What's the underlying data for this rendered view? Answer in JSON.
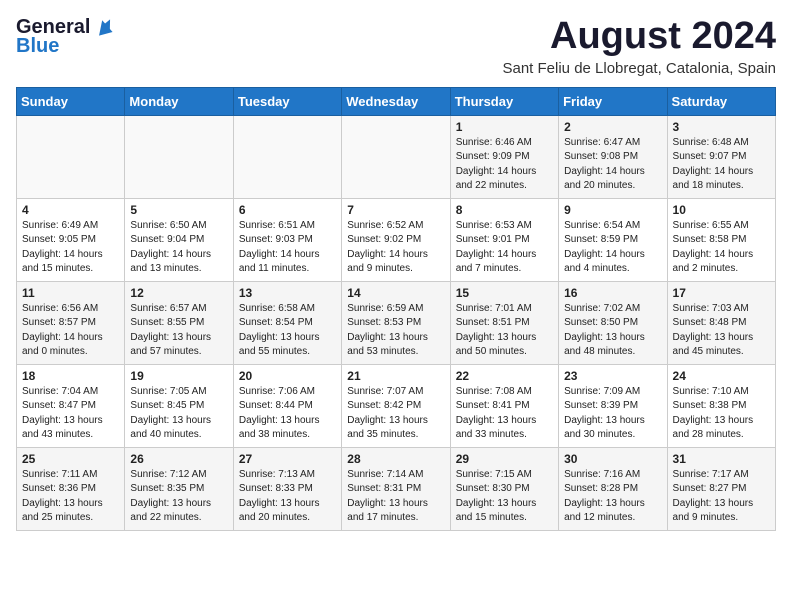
{
  "header": {
    "logo_general": "General",
    "logo_blue": "Blue",
    "month_title": "August 2024",
    "location": "Sant Feliu de Llobregat, Catalonia, Spain"
  },
  "calendar": {
    "weekdays": [
      "Sunday",
      "Monday",
      "Tuesday",
      "Wednesday",
      "Thursday",
      "Friday",
      "Saturday"
    ],
    "weeks": [
      [
        {
          "day": "",
          "info": ""
        },
        {
          "day": "",
          "info": ""
        },
        {
          "day": "",
          "info": ""
        },
        {
          "day": "",
          "info": ""
        },
        {
          "day": "1",
          "info": "Sunrise: 6:46 AM\nSunset: 9:09 PM\nDaylight: 14 hours\nand 22 minutes."
        },
        {
          "day": "2",
          "info": "Sunrise: 6:47 AM\nSunset: 9:08 PM\nDaylight: 14 hours\nand 20 minutes."
        },
        {
          "day": "3",
          "info": "Sunrise: 6:48 AM\nSunset: 9:07 PM\nDaylight: 14 hours\nand 18 minutes."
        }
      ],
      [
        {
          "day": "4",
          "info": "Sunrise: 6:49 AM\nSunset: 9:05 PM\nDaylight: 14 hours\nand 15 minutes."
        },
        {
          "day": "5",
          "info": "Sunrise: 6:50 AM\nSunset: 9:04 PM\nDaylight: 14 hours\nand 13 minutes."
        },
        {
          "day": "6",
          "info": "Sunrise: 6:51 AM\nSunset: 9:03 PM\nDaylight: 14 hours\nand 11 minutes."
        },
        {
          "day": "7",
          "info": "Sunrise: 6:52 AM\nSunset: 9:02 PM\nDaylight: 14 hours\nand 9 minutes."
        },
        {
          "day": "8",
          "info": "Sunrise: 6:53 AM\nSunset: 9:01 PM\nDaylight: 14 hours\nand 7 minutes."
        },
        {
          "day": "9",
          "info": "Sunrise: 6:54 AM\nSunset: 8:59 PM\nDaylight: 14 hours\nand 4 minutes."
        },
        {
          "day": "10",
          "info": "Sunrise: 6:55 AM\nSunset: 8:58 PM\nDaylight: 14 hours\nand 2 minutes."
        }
      ],
      [
        {
          "day": "11",
          "info": "Sunrise: 6:56 AM\nSunset: 8:57 PM\nDaylight: 14 hours\nand 0 minutes."
        },
        {
          "day": "12",
          "info": "Sunrise: 6:57 AM\nSunset: 8:55 PM\nDaylight: 13 hours\nand 57 minutes."
        },
        {
          "day": "13",
          "info": "Sunrise: 6:58 AM\nSunset: 8:54 PM\nDaylight: 13 hours\nand 55 minutes."
        },
        {
          "day": "14",
          "info": "Sunrise: 6:59 AM\nSunset: 8:53 PM\nDaylight: 13 hours\nand 53 minutes."
        },
        {
          "day": "15",
          "info": "Sunrise: 7:01 AM\nSunset: 8:51 PM\nDaylight: 13 hours\nand 50 minutes."
        },
        {
          "day": "16",
          "info": "Sunrise: 7:02 AM\nSunset: 8:50 PM\nDaylight: 13 hours\nand 48 minutes."
        },
        {
          "day": "17",
          "info": "Sunrise: 7:03 AM\nSunset: 8:48 PM\nDaylight: 13 hours\nand 45 minutes."
        }
      ],
      [
        {
          "day": "18",
          "info": "Sunrise: 7:04 AM\nSunset: 8:47 PM\nDaylight: 13 hours\nand 43 minutes."
        },
        {
          "day": "19",
          "info": "Sunrise: 7:05 AM\nSunset: 8:45 PM\nDaylight: 13 hours\nand 40 minutes."
        },
        {
          "day": "20",
          "info": "Sunrise: 7:06 AM\nSunset: 8:44 PM\nDaylight: 13 hours\nand 38 minutes."
        },
        {
          "day": "21",
          "info": "Sunrise: 7:07 AM\nSunset: 8:42 PM\nDaylight: 13 hours\nand 35 minutes."
        },
        {
          "day": "22",
          "info": "Sunrise: 7:08 AM\nSunset: 8:41 PM\nDaylight: 13 hours\nand 33 minutes."
        },
        {
          "day": "23",
          "info": "Sunrise: 7:09 AM\nSunset: 8:39 PM\nDaylight: 13 hours\nand 30 minutes."
        },
        {
          "day": "24",
          "info": "Sunrise: 7:10 AM\nSunset: 8:38 PM\nDaylight: 13 hours\nand 28 minutes."
        }
      ],
      [
        {
          "day": "25",
          "info": "Sunrise: 7:11 AM\nSunset: 8:36 PM\nDaylight: 13 hours\nand 25 minutes."
        },
        {
          "day": "26",
          "info": "Sunrise: 7:12 AM\nSunset: 8:35 PM\nDaylight: 13 hours\nand 22 minutes."
        },
        {
          "day": "27",
          "info": "Sunrise: 7:13 AM\nSunset: 8:33 PM\nDaylight: 13 hours\nand 20 minutes."
        },
        {
          "day": "28",
          "info": "Sunrise: 7:14 AM\nSunset: 8:31 PM\nDaylight: 13 hours\nand 17 minutes."
        },
        {
          "day": "29",
          "info": "Sunrise: 7:15 AM\nSunset: 8:30 PM\nDaylight: 13 hours\nand 15 minutes."
        },
        {
          "day": "30",
          "info": "Sunrise: 7:16 AM\nSunset: 8:28 PM\nDaylight: 13 hours\nand 12 minutes."
        },
        {
          "day": "31",
          "info": "Sunrise: 7:17 AM\nSunset: 8:27 PM\nDaylight: 13 hours\nand 9 minutes."
        }
      ]
    ]
  }
}
